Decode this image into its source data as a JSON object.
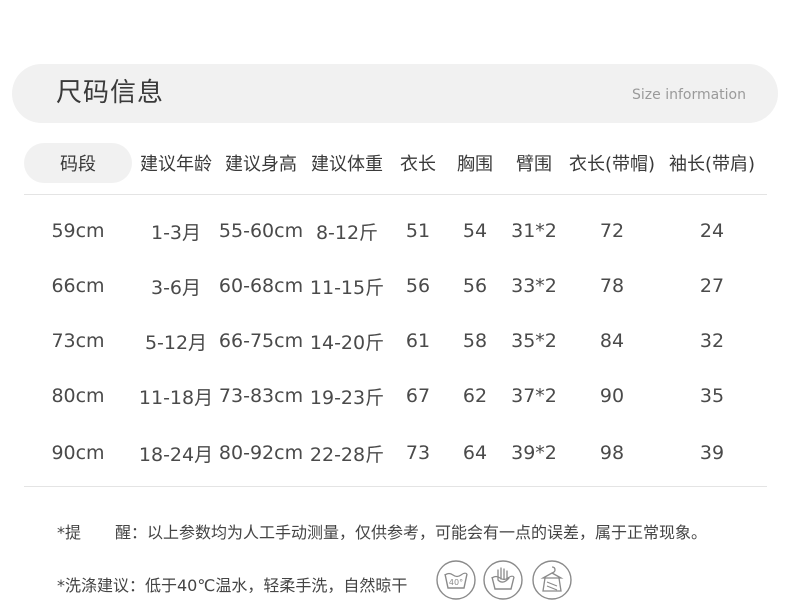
{
  "title": {
    "cn": "尺码信息",
    "en": "Size information"
  },
  "table": {
    "headers": [
      "码段",
      "建议年龄",
      "建议身高",
      "建议体重",
      "衣长",
      "胸围",
      "臂围",
      "衣长(带帽)",
      "袖长(带肩)"
    ],
    "rows": [
      [
        "59cm",
        "1-3月",
        "55-60cm",
        "8-12斤",
        "51",
        "54",
        "31*2",
        "72",
        "24"
      ],
      [
        "66cm",
        "3-6月",
        "60-68cm",
        "11-15斤",
        "56",
        "56",
        "33*2",
        "78",
        "27"
      ],
      [
        "73cm",
        "5-12月",
        "66-75cm",
        "14-20斤",
        "61",
        "58",
        "35*2",
        "84",
        "32"
      ],
      [
        "80cm",
        "11-18月",
        "73-83cm",
        "19-23斤",
        "67",
        "62",
        "37*2",
        "90",
        "35"
      ],
      [
        "90cm",
        "18-24月",
        "80-92cm",
        "22-28斤",
        "73",
        "64",
        "39*2",
        "98",
        "39"
      ]
    ]
  },
  "notes": {
    "reminder_label_a": "*提",
    "reminder_label_b": "醒：",
    "reminder_text": "以上参数均为人工手动测量，仅供参考，可能会有一点的误差，属于正常现象。",
    "wash_text": "*洗涤建议：低于40℃温水，轻柔手洗，自然晾干",
    "wash_icon_temp": "40°"
  },
  "icons": [
    "wash-40-icon",
    "hand-wash-icon",
    "hang-dry-icon"
  ],
  "colors": {
    "pill_bg": "#f1f1f1",
    "text": "#444444",
    "icon": "#8a8a8a"
  }
}
